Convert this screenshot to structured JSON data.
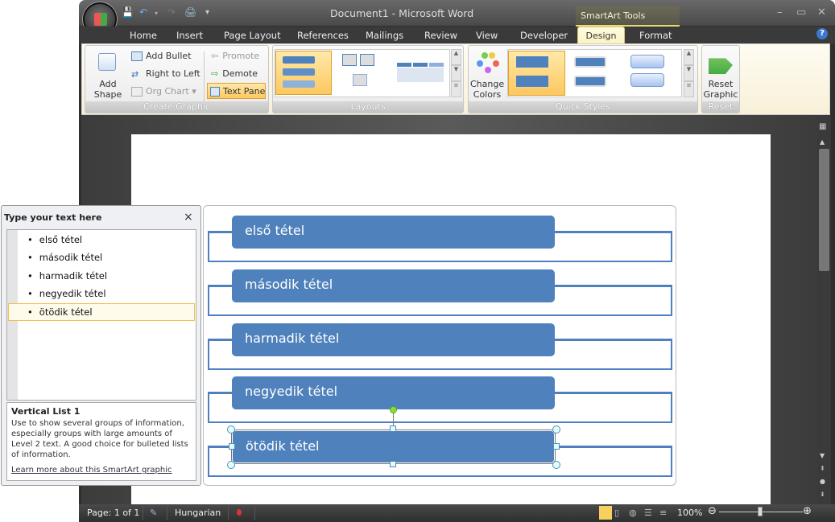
{
  "window": {
    "title": "Document1 - Microsoft Word",
    "contextual_tab": "SmartArt Tools"
  },
  "tabs": [
    "Home",
    "Insert",
    "Page Layout",
    "References",
    "Mailings",
    "Review",
    "View",
    "Developer",
    "Design",
    "Format"
  ],
  "active_tab": "Design",
  "ribbon": {
    "create_graphic": {
      "label": "Create Graphic",
      "add_shape": "Add Shape",
      "add_bullet": "Add Bullet",
      "right_to_left": "Right to Left",
      "org_chart": "Org Chart",
      "promote": "Promote",
      "demote": "Demote",
      "text_pane": "Text Pane"
    },
    "layouts": {
      "label": "Layouts"
    },
    "quick_styles": {
      "label": "Quick Styles",
      "change_colors": "Change Colors"
    },
    "reset": {
      "label": "Reset",
      "reset_graphic": "Reset Graphic"
    }
  },
  "text_pane": {
    "title": "Type your text here",
    "items": [
      "első tétel",
      "második tétel",
      "harmadik tétel",
      "negyedik tétel",
      "ötödik tétel"
    ],
    "selected_index": 4,
    "desc_title": "Vertical List 1",
    "desc_text": "Use to show several groups of information, especially groups with large amounts of Level 2 text. A good choice for bulleted lists of information.",
    "learn_more": "Learn more about this SmartArt graphic"
  },
  "smartart": {
    "items": [
      "első tétel",
      "második tétel",
      "harmadik tétel",
      "negyedik tétel",
      "ötödik tétel"
    ],
    "color": "#4f81bd"
  },
  "status": {
    "page": "Page: 1 of 1",
    "language": "Hungarian",
    "zoom": "100%"
  }
}
